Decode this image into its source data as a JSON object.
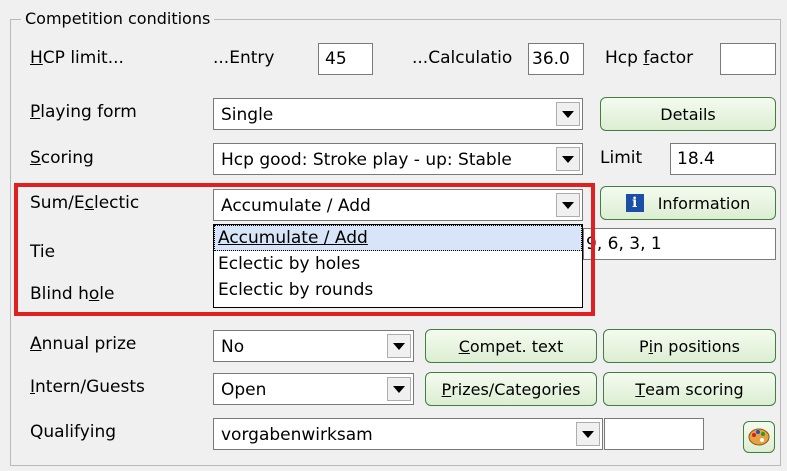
{
  "group": {
    "title": "Competition conditions"
  },
  "hcp_limit": {
    "label_u": "H",
    "label_rest": "CP limit...",
    "entry_label": "...Entry",
    "entry_value": "45",
    "calc_label": "...Calculatio",
    "calc_value": "36.0",
    "factor_label_a": "Hcp ",
    "factor_label_u": "f",
    "factor_label_b": "actor",
    "factor_value": ""
  },
  "playing_form": {
    "label_u": "P",
    "label_rest": "laying form",
    "value": "Single",
    "details_button": "Details"
  },
  "scoring": {
    "label_u": "S",
    "label_rest": "coring",
    "value": "Hcp good: Stroke play - up: Stable",
    "limit_label": "Limit",
    "limit_value": "18.4"
  },
  "sum_eclectic": {
    "label_a": "Sum/E",
    "label_u": "c",
    "label_b": "lectic",
    "value": "Accumulate / Add",
    "info_button": "Information",
    "options": [
      "Accumulate / Add",
      "Eclectic by holes",
      "Eclectic by rounds"
    ]
  },
  "tie": {
    "label": "Tie",
    "value": "9, 6, 3, 1"
  },
  "blind_hole": {
    "label_a": "Blind h",
    "label_u": "o",
    "label_b": "le"
  },
  "annual_prize": {
    "label_u": "A",
    "label_rest": "nnual prize",
    "value": "No",
    "compet_text_u": "C",
    "compet_text_rest": "ompet. text",
    "pin_a": "P",
    "pin_u": "i",
    "pin_b": "n positions"
  },
  "intern_guests": {
    "label_u": "I",
    "label_rest": "ntern/Guests",
    "value": "Open",
    "prizes_u": "P",
    "prizes_rest": "rizes/Categories",
    "team_u": "T",
    "team_rest": "eam scoring"
  },
  "qualifying": {
    "label": "Qualifying",
    "value": "vorgabenwirksam",
    "extra_value": ""
  }
}
